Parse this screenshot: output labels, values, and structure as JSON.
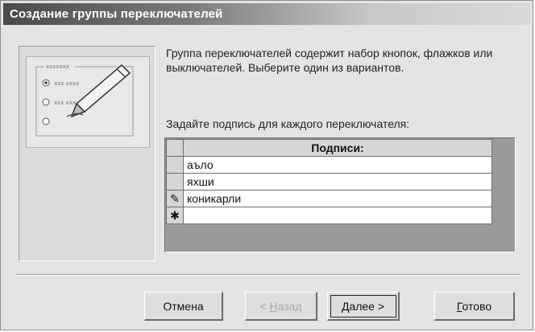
{
  "window": {
    "title": "Создание группы переключателей"
  },
  "illustration": {
    "group_label": "xxxxxxx",
    "options": [
      "xxx xxxx",
      "xxx xxx",
      ""
    ]
  },
  "description": "Группа переключателей содержит набор кнопок, флажков или выключателей. Выберите один из вариантов.",
  "prompt": "Задайте подпись для каждого переключателя:",
  "grid": {
    "header": "Подписи:",
    "rows": [
      "аъло",
      "яхши",
      "коникарли",
      ""
    ],
    "row_markers": [
      "",
      "",
      "✎",
      "✱"
    ]
  },
  "buttons": {
    "cancel": "Отмена",
    "back_mnemonic": "Н",
    "back_rest": "азад",
    "back_prefix": "< ",
    "next_mnemonic": "Д",
    "next_rest": "алее >",
    "finish_mnemonic": "Г",
    "finish_rest": "отово"
  }
}
